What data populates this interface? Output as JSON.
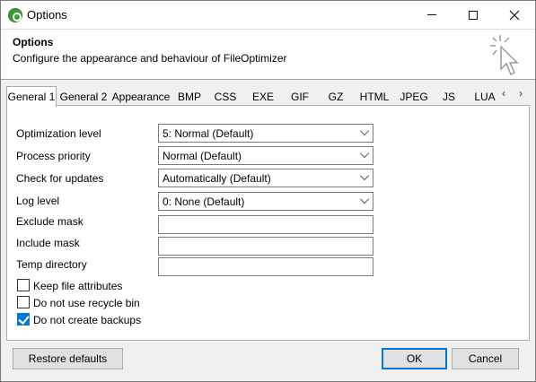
{
  "window": {
    "title": "Options",
    "minimize_icon": "minimize-icon",
    "maximize_icon": "maximize-icon",
    "close_icon": "close-icon"
  },
  "header": {
    "title": "Options",
    "subtitle": "Configure the appearance and behaviour of FileOptimizer",
    "art_icon": "cursor-click-icon"
  },
  "tabs": [
    {
      "label": "General 1",
      "active": true
    },
    {
      "label": "General 2",
      "active": false
    },
    {
      "label": "Appearance",
      "active": false
    },
    {
      "label": "BMP",
      "active": false
    },
    {
      "label": "CSS",
      "active": false
    },
    {
      "label": "EXE",
      "active": false
    },
    {
      "label": "GIF",
      "active": false
    },
    {
      "label": "GZ",
      "active": false
    },
    {
      "label": "HTML",
      "active": false
    },
    {
      "label": "JPEG",
      "active": false
    },
    {
      "label": "JS",
      "active": false
    },
    {
      "label": "LUA",
      "active": false
    }
  ],
  "tab_scroll": {
    "left": "‹",
    "right": "›"
  },
  "fields": {
    "optimization_level": {
      "label": "Optimization level",
      "value": "5: Normal (Default)"
    },
    "process_priority": {
      "label": "Process priority",
      "value": "Normal (Default)"
    },
    "check_for_updates": {
      "label": "Check for updates",
      "value": "Automatically (Default)"
    },
    "log_level": {
      "label": "Log level",
      "value": "0: None (Default)"
    },
    "exclude_mask": {
      "label": "Exclude mask",
      "value": ""
    },
    "include_mask": {
      "label": "Include mask",
      "value": ""
    },
    "temp_directory": {
      "label": "Temp directory",
      "value": ""
    }
  },
  "checkboxes": {
    "keep_file_attributes": {
      "label": "Keep file attributes",
      "checked": false
    },
    "do_not_use_recycle_bin": {
      "label": "Do not use recycle bin",
      "checked": false
    },
    "do_not_create_backups": {
      "label": "Do not create backups",
      "checked": true
    }
  },
  "buttons": {
    "restore_defaults": "Restore defaults",
    "ok": "OK",
    "cancel": "Cancel"
  },
  "colors": {
    "accent": "#0078d7",
    "app_icon": "#3c9a3c"
  }
}
